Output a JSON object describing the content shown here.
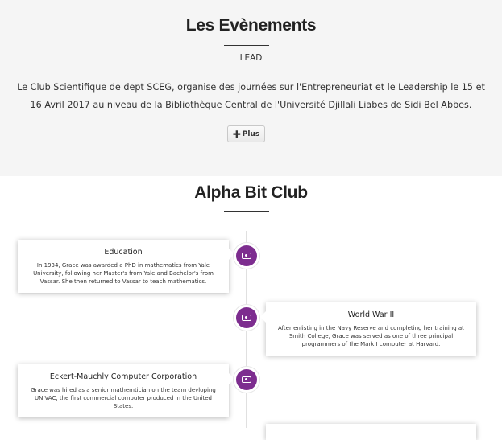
{
  "events": {
    "title": "Les Evènements",
    "subtitle": "LEAD",
    "description": "Le Club Scientifique de dept SCEG, organise des journées sur l'Entrepreneuriat et le Leadership le 15 et 16 Avril 2017 au niveau de la Bibliothèque Central de l'Université Djillali Liabes de Sidi Bel Abbes.",
    "more_button": {
      "icon": "plus-icon",
      "label": "Plus"
    }
  },
  "club": {
    "title": "Alpha Bit Club"
  },
  "timeline": {
    "items": [
      {
        "title": "Education",
        "text": "In 1934, Grace was awarded a PhD in mathematics from Yale University, following her Master's from Yale and Bachelor's from Vassar. She then returned to Vassar to teach mathematics.",
        "icon": "card-icon"
      },
      {
        "title": "World War II",
        "text": "After enlisting in the Navy Reserve and completing her training at Smith College, Grace was served as one of three principal programmers of the Mark I computer at Harvard.",
        "icon": "card-icon"
      },
      {
        "title": "Eckert-Mauchly Computer Corporation",
        "text": "Grace was hired as a senior mathemtician on the team devloping UNIVAC, the first commercial computer produced in the United States.",
        "icon": "card-icon"
      }
    ]
  },
  "colors": {
    "accent": "#7d2d8f",
    "section_bg": "#f5f5f5"
  }
}
